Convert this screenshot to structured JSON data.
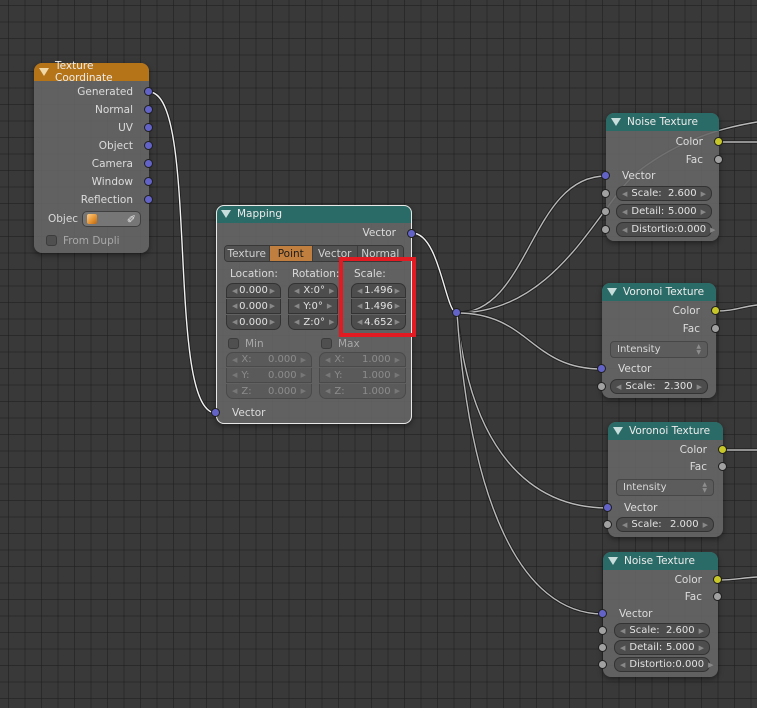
{
  "editor": "Node Editor",
  "colors": {
    "background": "#393939",
    "header_input": "#b57418",
    "header_texture": "#2b6b67",
    "socket_vector": "#6363c7",
    "socket_color": "#c7c729",
    "socket_value": "#a1a1a1",
    "active_tab": "#c17f3f",
    "highlight": "#e21b23"
  },
  "nodes": {
    "texture_coordinate": {
      "title": "Texture Coordinate",
      "outputs": [
        "Generated",
        "Normal",
        "UV",
        "Object",
        "Camera",
        "Window",
        "Reflection"
      ],
      "object_label": "Objec",
      "object_icon": "cube-icon",
      "picker_icon": "eyedropper-icon",
      "from_dupli_label": "From Dupli",
      "from_dupli_checked": false
    },
    "mapping": {
      "title": "Mapping",
      "output": "Vector",
      "input": "Vector",
      "tabs": [
        "Texture",
        "Point",
        "Vector",
        "Normal"
      ],
      "active_tab": "Point",
      "location_label": "Location:",
      "rotation_label": "Rotation:",
      "scale_label": "Scale:",
      "location": [
        "0.000",
        "0.000",
        "0.000"
      ],
      "rotation": [
        {
          "axis": "X:",
          "value": "0°"
        },
        {
          "axis": "Y:",
          "value": "0°"
        },
        {
          "axis": "Z:",
          "value": "0°"
        }
      ],
      "scale": [
        "1.496",
        "1.496",
        "4.652"
      ],
      "min_label": "Min",
      "max_label": "Max",
      "min_checked": false,
      "max_checked": false,
      "min": [
        {
          "axis": "X:",
          "value": "0.000"
        },
        {
          "axis": "Y:",
          "value": "0.000"
        },
        {
          "axis": "Z:",
          "value": "0.000"
        }
      ],
      "max": [
        {
          "axis": "X:",
          "value": "1.000"
        },
        {
          "axis": "Y:",
          "value": "1.000"
        },
        {
          "axis": "Z:",
          "value": "1.000"
        }
      ]
    },
    "noise_1": {
      "title": "Noise Texture",
      "outputs": [
        "Color",
        "Fac"
      ],
      "input_vector": "Vector",
      "fields": [
        {
          "label": "Scale:",
          "value": "2.600"
        },
        {
          "label": "Detail:",
          "value": "5.000"
        },
        {
          "label": "Distortio:",
          "value": "0.000"
        }
      ]
    },
    "voronoi_1": {
      "title": "Voronoi Texture",
      "outputs": [
        "Color",
        "Fac"
      ],
      "coloring": "Intensity",
      "input_vector": "Vector",
      "fields": [
        {
          "label": "Scale:",
          "value": "2.300"
        }
      ]
    },
    "voronoi_2": {
      "title": "Voronoi Texture",
      "outputs": [
        "Color",
        "Fac"
      ],
      "coloring": "Intensity",
      "input_vector": "Vector",
      "fields": [
        {
          "label": "Scale:",
          "value": "2.000"
        }
      ]
    },
    "noise_2": {
      "title": "Noise Texture",
      "outputs": [
        "Color",
        "Fac"
      ],
      "input_vector": "Vector",
      "fields": [
        {
          "label": "Scale:",
          "value": "2.600"
        },
        {
          "label": "Detail:",
          "value": "5.000"
        },
        {
          "label": "Distortio:",
          "value": "0.000"
        }
      ]
    }
  }
}
